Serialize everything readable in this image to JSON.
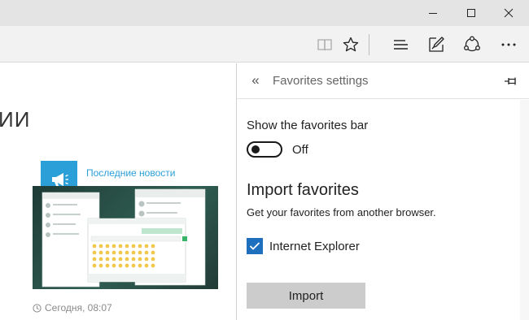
{
  "window": {
    "minimize_icon": "minimize-icon",
    "maximize_icon": "maximize-icon",
    "close_icon": "close-icon"
  },
  "toolbar": {
    "icons": [
      "reading-view-icon",
      "favorite-star-icon",
      "hub-icon",
      "web-note-icon",
      "share-icon",
      "more-icon"
    ],
    "more_label": "···"
  },
  "page": {
    "heading": "ИИ",
    "news_title": "Последние новости",
    "news_date": "Сегодня, 08:07",
    "accent_color": "#2b9fd8"
  },
  "favorites_panel": {
    "title": "Favorites settings",
    "back_label": "«",
    "show_bar_label": "Show the favorites bar",
    "toggle_state": "Off",
    "import_heading": "Import favorites",
    "import_description": "Get your favorites from another browser.",
    "browser_option": "Internet Explorer",
    "browser_checked": true,
    "import_button": "Import",
    "checkbox_color": "#1f6fbf"
  }
}
